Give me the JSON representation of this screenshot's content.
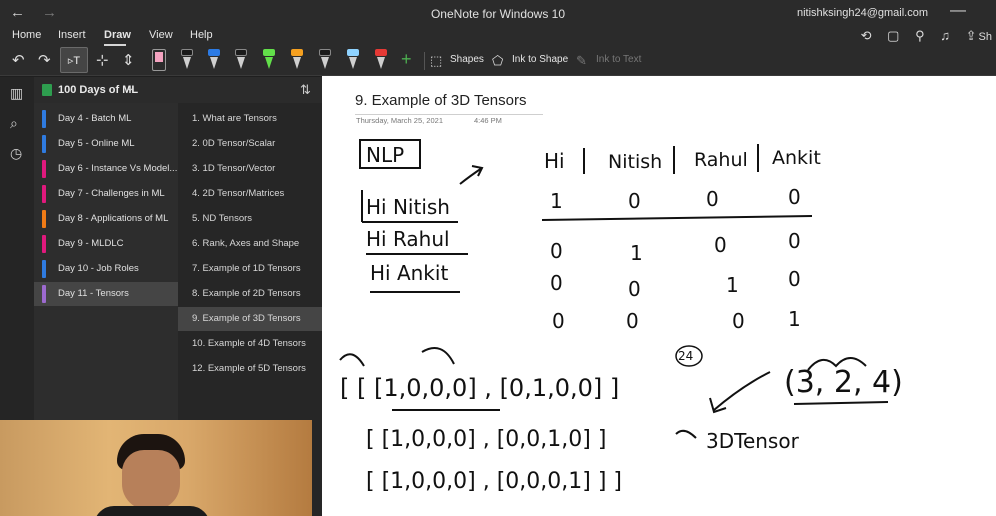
{
  "titlebar": {
    "back": "←",
    "forward": "→",
    "app_title": "OneNote for Windows 10",
    "account": "nitishksingh24@gmail.com",
    "minimize": "—"
  },
  "menu": {
    "tabs": [
      "Home",
      "Insert",
      "Draw",
      "View",
      "Help"
    ],
    "active": "Draw",
    "share_partial": "Sh"
  },
  "ribbon": {
    "undo": "↶",
    "redo": "↷",
    "select_tool": "▹T",
    "lasso": "⊹",
    "space": "⇕",
    "add_pen": "+",
    "shapes_label": "Shapes",
    "ink_to_shape_label": "Ink to Shape",
    "ink_to_text_label": "Ink to Text",
    "highlighter_colors": [
      "#f4a3c0",
      "#62e04a"
    ],
    "pen_colors": [
      "#1a1a1a",
      "#2c7be5",
      "#1a1a1a",
      "#1a1a1a",
      "#f5a020",
      "#1a1a1a",
      "#8fd3ff",
      "#e53935"
    ]
  },
  "notebook": {
    "title": "100 Days of ML",
    "chevron": "⌄",
    "sort_icon": "⇅"
  },
  "sections": [
    {
      "label": "Day 4 - Batch ML",
      "color": "#2f7be0"
    },
    {
      "label": "Day 5 - Online ML",
      "color": "#2f7be0"
    },
    {
      "label": "Day 6 - Instance Vs Model...",
      "color": "#e0197d"
    },
    {
      "label": "Day 7 - Challenges in ML",
      "color": "#e0197d"
    },
    {
      "label": "Day 8 - Applications of ML",
      "color": "#f07b16"
    },
    {
      "label": "Day 9 - MLDLC",
      "color": "#e0197d"
    },
    {
      "label": "Day 10 - Job Roles",
      "color": "#2f7be0"
    },
    {
      "label": "Day 11 - Tensors",
      "color": "#9d6ad0"
    }
  ],
  "active_section": 7,
  "pages": [
    "1. What are Tensors",
    "2. 0D Tensor/Scalar",
    "3. 1D Tensor/Vector",
    "4. 2D Tensor/Matrices",
    "5. ND Tensors",
    "6. Rank, Axes and Shape",
    "7. Example of 1D Tensors",
    "8. Example of 2D Tensors",
    "9. Example of 3D Tensors",
    "10. Example of 4D Tensors",
    "12. Example of 5D Tensors"
  ],
  "active_page": 8,
  "note": {
    "title": "9. Example of 3D Tensors",
    "date": "Thursday, March 25, 2021",
    "time": "4:46 PM"
  },
  "ink": {
    "nlp_label": "NLP",
    "sentences": [
      "Hi Nitish",
      "Hi Rahul",
      "Hi Ankit"
    ],
    "vocab_header": [
      "Hi",
      "Nitish",
      "Rahul",
      "Ankit"
    ],
    "rows": [
      [
        "1",
        "0",
        "0",
        "0"
      ],
      [
        "0",
        "1",
        "0",
        "0"
      ],
      [
        "0",
        "0",
        "1",
        "0"
      ],
      [
        "0",
        "0",
        "0",
        "1"
      ]
    ],
    "tensor_line_1": "[ [ [1,0,0,0] , [0,1,0,0] ]",
    "tensor_line_2": "[ [1,0,0,0] , [0,0,1,0] ]",
    "tensor_line_3": "[ [1,0,0,0] , [0,0,0,1] ] ]",
    "tensor_label": "3DTensor",
    "shape": "(3, 2, 4)",
    "annotation": "24"
  }
}
